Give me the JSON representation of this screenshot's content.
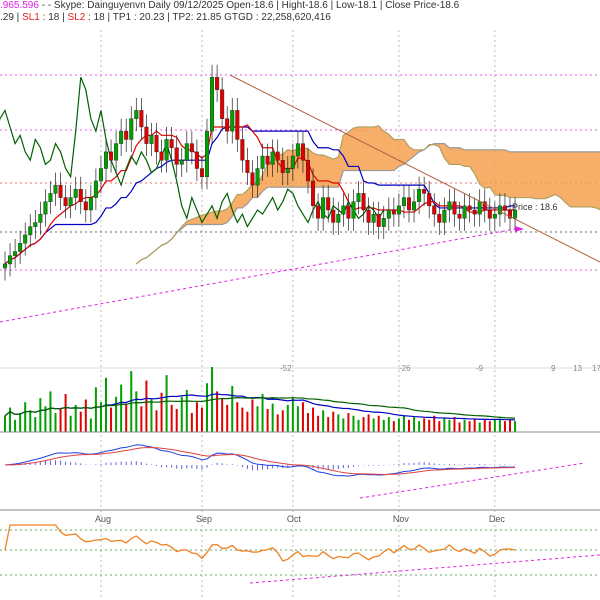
{
  "header": {
    "line1_prefix": ".965.596",
    "line1": " - - Skype: Dainguyenvn  Daily 09/12/2025 Open-18.6  | Hight-18.6  | Low-18.1  | Close Price-18.6",
    "line2_a": ".29 | ",
    "sl1_label": "SL1",
    "sl1_value": " : 18 | ",
    "sl2_label": "SL2",
    "sl2_value": " : 18 |  TP1 : 20.23 | TP2: 21.85 GTGD : 22,258,620,416"
  },
  "price_label": "Price : 18.6",
  "colors": {
    "up": "#00a000",
    "down": "#e00000",
    "cloud": "#f5a050",
    "tenkan": "#e00000",
    "kijun": "#0000c0",
    "chikou": "#006000"
  },
  "chart_data": {
    "type": "candlestick",
    "title": "Daily 09/12/2025",
    "months": [
      {
        "label": "Aug",
        "bar": 19
      },
      {
        "label": "Sep",
        "bar": 39
      },
      {
        "label": "Oct",
        "bar": 57
      },
      {
        "label": "Nov",
        "bar": 78
      },
      {
        "label": "Dec",
        "bar": 97
      }
    ],
    "offset_labels": [
      "-52",
      "-26",
      "-9",
      "9",
      "13",
      "17"
    ],
    "levels": {
      "tp1": 20.23,
      "tp2": 21.85,
      "sl1": 18,
      "sl2": 18,
      "last": 18.6
    },
    "closes": [
      17.3,
      17.5,
      17.6,
      17.8,
      18.0,
      18.2,
      18.3,
      18.5,
      18.8,
      19.0,
      19.2,
      18.9,
      18.7,
      18.9,
      19.1,
      18.8,
      18.6,
      18.9,
      19.3,
      19.6,
      20.0,
      19.8,
      20.2,
      20.5,
      20.3,
      20.8,
      21.0,
      20.6,
      20.2,
      20.4,
      20.0,
      19.8,
      20.3,
      20.1,
      19.7,
      19.8,
      20.2,
      20.0,
      19.6,
      19.4,
      20.5,
      21.8,
      21.5,
      20.8,
      20.5,
      21.0,
      20.3,
      19.8,
      19.5,
      19.2,
      19.6,
      19.9,
      19.7,
      20.0,
      19.8,
      19.5,
      19.6,
      19.9,
      20.2,
      19.8,
      19.3,
      18.7,
      18.4,
      18.9,
      18.6,
      18.3,
      18.5,
      18.7,
      18.4,
      18.8,
      19.0,
      18.6,
      18.3,
      18.5,
      18.2,
      18.4,
      18.6,
      18.5,
      18.7,
      18.9,
      18.6,
      18.8,
      19.1,
      19.0,
      18.7,
      18.5,
      18.3,
      18.6,
      18.8,
      18.5,
      18.4,
      18.7,
      18.6,
      18.5,
      18.8,
      18.6,
      18.4,
      18.5,
      18.7,
      18.6,
      18.4,
      18.6
    ],
    "volume": [
      12,
      18,
      9,
      14,
      22,
      16,
      11,
      25,
      19,
      30,
      14,
      17,
      28,
      12,
      20,
      15,
      24,
      10,
      33,
      22,
      40,
      18,
      26,
      35,
      21,
      45,
      30,
      19,
      38,
      24,
      16,
      29,
      42,
      20,
      17,
      26,
      31,
      14,
      22,
      18,
      36,
      48,
      30,
      25,
      20,
      34,
      22,
      18,
      15,
      24,
      19,
      28,
      17,
      21,
      13,
      16,
      20,
      25,
      19,
      22,
      14,
      18,
      12,
      16,
      11,
      15,
      13,
      10,
      14,
      12,
      9,
      11,
      13,
      10,
      12,
      9,
      11,
      8,
      10,
      12,
      9,
      11,
      8,
      10,
      9,
      12,
      8,
      10,
      9,
      11,
      7,
      9,
      8,
      10,
      7,
      9,
      8,
      9,
      10,
      8,
      9,
      8
    ]
  }
}
